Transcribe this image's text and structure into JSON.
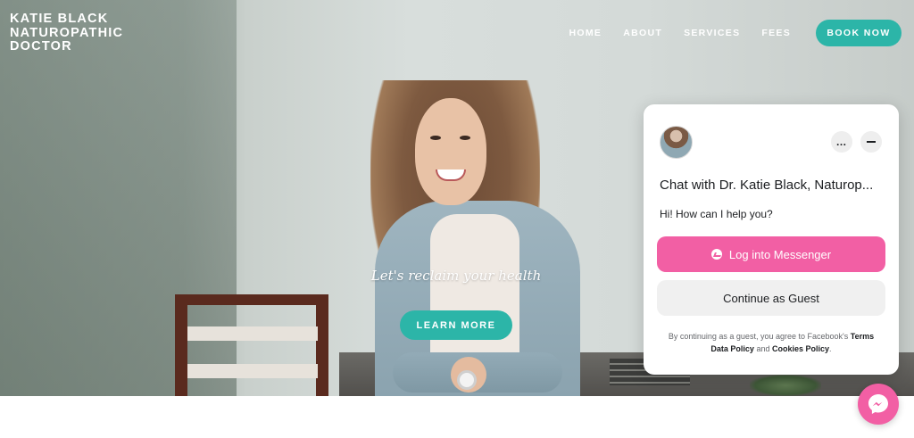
{
  "brand": {
    "line1": "KATIE BLACK",
    "line2": "NATUROPATHIC",
    "line3": "DOCTOR"
  },
  "nav": {
    "items": [
      "HOME",
      "ABOUT",
      "SERVICES",
      "FEES"
    ],
    "cta": "BOOK NOW"
  },
  "hero": {
    "tagline": "Let's reclaim your health",
    "button": "LEARN MORE"
  },
  "chat": {
    "title": "Chat with Dr. Katie Black, Naturop...",
    "greeting": "Hi! How can I help you?",
    "primary_button": "Log into Messenger",
    "secondary_button": "Continue as Guest",
    "more_icon": "…",
    "legal": {
      "prefix": "By continuing as a guest, you agree to Facebook's",
      "terms": "Terms",
      "data_policy": "Data Policy",
      "and": "and",
      "cookies_policy": "Cookies Policy",
      "suffix": "."
    }
  },
  "colors": {
    "accent_teal": "#2cb5a8",
    "messenger_pink": "#f25fa4"
  },
  "icons": {
    "messenger": "messenger-icon",
    "more": "more-icon",
    "minimize": "minimize-icon"
  }
}
